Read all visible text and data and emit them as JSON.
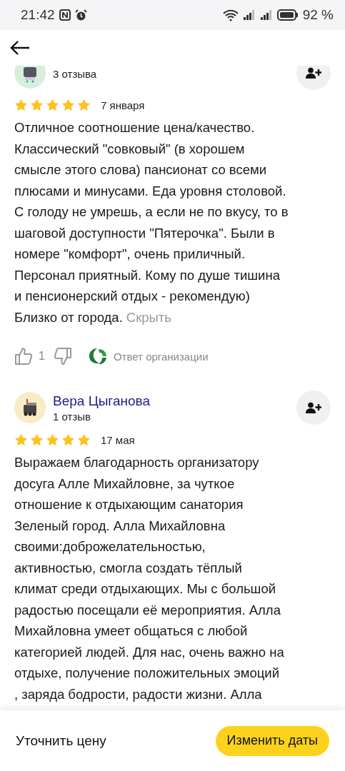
{
  "status_bar": {
    "time": "21:42",
    "battery": "92 %"
  },
  "reviews": [
    {
      "count": "3 отзыва",
      "stars": 5,
      "date": "7 января",
      "text": "Отличное соотношение цена/качество.\nКлассический \"совковый\" (в хорошем\nсмысле этого слова) пансионат со всеми\nплюсами и минусами. Еда уровня столовой.\nС голоду не умрешь, а если не по вкусу, то в\nшаговой доступности \"Пятерочка\". Были в\nномере \"комфорт\", очень приличный.\nПерсонал приятный. Кому по душе тишина\nи пенсионерский отдых - рекомендую)\nБлизко от города.",
      "toggle": "Скрыть",
      "likes": "1",
      "org_reply": "Ответ организации"
    },
    {
      "author": "Вера Цыганова",
      "count": "1 отзыв",
      "stars": 5,
      "date": "17 мая",
      "text": "Выражаем благодарность организатору\nдосуга Алле Михайловне, за чуткое\nотношение к отдыхающим санатория\nЗеленый город. Алла Михайловна\nсвоими:доброжелательностью,\nактивностью, смогла создать тёплый\nклимат среди отдыхающих. Мы с большой\nрадостью посещали её мероприятия. Алла\nМихайловна умеет общаться с любой\nкатегорией людей. Для нас, очень важно на\nотдыхе, получение положительных эмоций\n, заряда бодрости, радости жизни. Алла"
    }
  ],
  "bottom": {
    "link": "Уточнить цену",
    "button": "Изменить даты"
  }
}
